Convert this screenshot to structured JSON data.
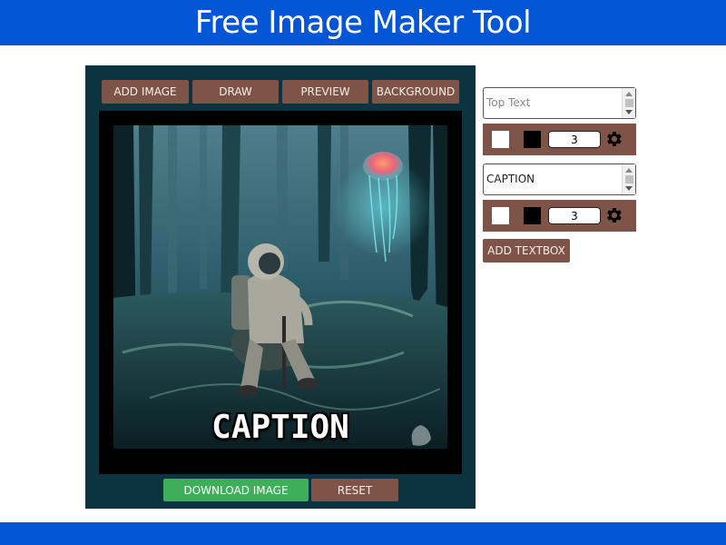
{
  "header": {
    "title": "Free Image Maker Tool"
  },
  "toolbar": {
    "add_image": "ADD IMAGE",
    "draw": "DRAW",
    "preview": "PREVIEW",
    "background": "BACKGROUND"
  },
  "canvas": {
    "caption": "CAPTION"
  },
  "actions": {
    "download": "DOWNLOAD IMAGE",
    "reset": "RESET"
  },
  "textboxes": [
    {
      "placeholder": "Top Text",
      "value": "",
      "fill_color": "#ffffff",
      "stroke_color": "#000000",
      "size": "3"
    },
    {
      "placeholder": "",
      "value": "CAPTION",
      "fill_color": "#ffffff",
      "stroke_color": "#000000",
      "size": "3"
    }
  ],
  "side": {
    "add_textbox": "ADD TEXTBOX"
  },
  "icons": {
    "settings": "gear-icon",
    "scroll_up": "arrow-up-icon",
    "scroll_down": "arrow-down-icon"
  },
  "colors": {
    "brand": "#0256d6",
    "panel": "#0c3340",
    "button": "#7e5448",
    "download": "#3fae5a"
  }
}
